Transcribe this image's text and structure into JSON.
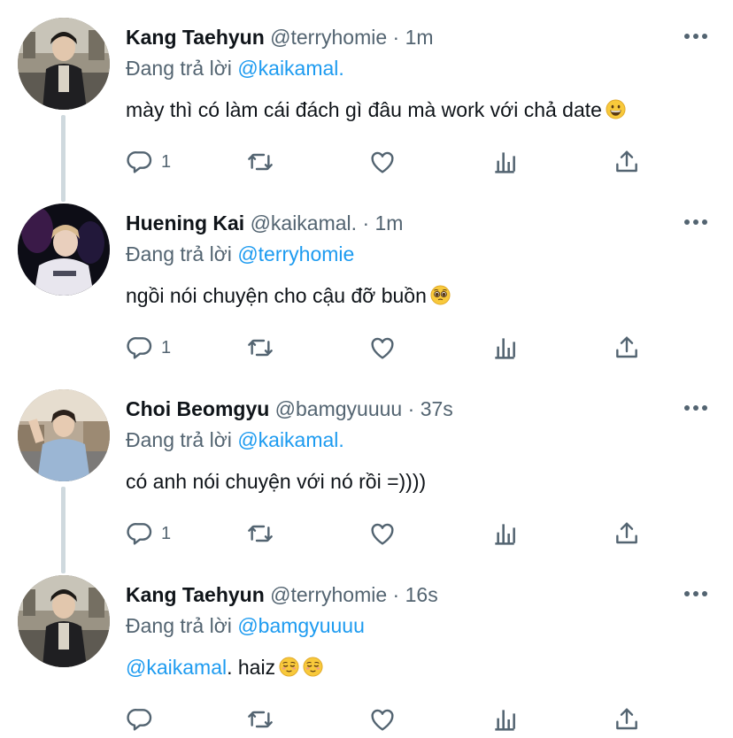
{
  "reply_prefix": "Đang trả lời",
  "tweets": [
    {
      "name": "Kang Taehyun",
      "handle": "@terryhomie",
      "separator": "·",
      "time": "1m",
      "reply_to": "@kaikamal.",
      "text": "mày thì có làm cái đách gì đâu mà work với chả date",
      "text_mention": "",
      "emojis": [
        "grinning-face"
      ],
      "reply_count": "1",
      "avatar": "avatar-photo"
    },
    {
      "name": "Huening Kai",
      "handle": "@kaikamal.",
      "separator": "·",
      "time": "1m",
      "reply_to": "@terryhomie",
      "text": "ngồi nói chuyện cho cậu đỡ buồn",
      "text_mention": "",
      "emojis": [
        "pleading-face"
      ],
      "reply_count": "1",
      "avatar": "avatar-photo"
    },
    {
      "name": "Choi Beomgyu",
      "handle": "@bamgyuuuu",
      "separator": "·",
      "time": "37s",
      "reply_to": "@kaikamal.",
      "text": "có anh nói chuyện với nó rồi =))))",
      "text_mention": "",
      "emojis": [],
      "reply_count": "1",
      "avatar": "avatar-photo"
    },
    {
      "name": "Kang Taehyun",
      "handle": "@terryhomie",
      "separator": "·",
      "time": "16s",
      "reply_to": "@bamgyuuuu",
      "text": ". haiz",
      "text_mention": "@kaikamal",
      "emojis": [
        "relieved-face",
        "relieved-face"
      ],
      "reply_count": "",
      "avatar": "avatar-photo"
    }
  ],
  "colors": {
    "text": "#0f1419",
    "secondary": "#536471",
    "link": "#1d9bf0",
    "thread_line": "#cfd9de"
  }
}
